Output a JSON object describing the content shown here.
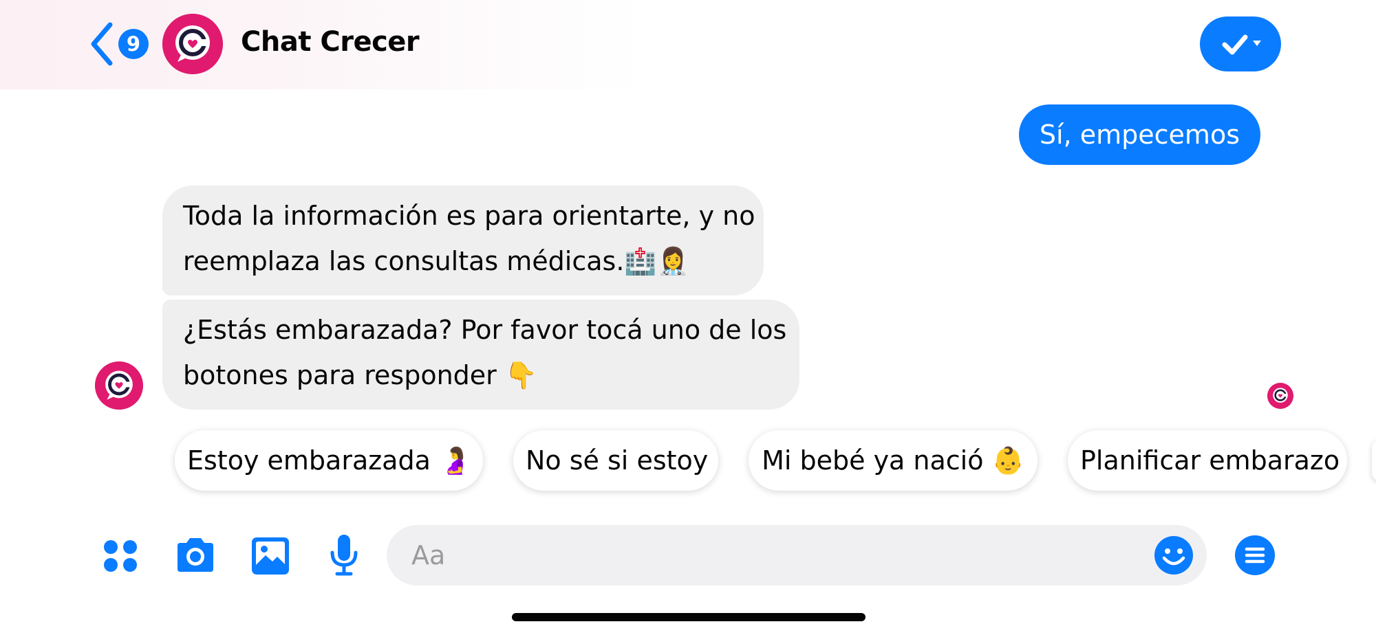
{
  "header": {
    "back_badge_count": "9",
    "title": "Chat Crecer",
    "icon_name": "checkmark-dropdown-icon"
  },
  "messages": {
    "outgoing": {
      "text": "Sí, empecemos"
    },
    "incoming": [
      {
        "line1": "Toda la información es para orientarte, y no",
        "line2_text": "reemplaza las consultas médicas.",
        "line2_emoji": "🏥👩‍⚕️"
      },
      {
        "line1": "¿Estás embarazada? Por favor tocá uno de los",
        "line2_text": "botones para responder ",
        "line2_emoji": "👇"
      }
    ]
  },
  "quick_replies": [
    {
      "label": "Estoy embarazada",
      "emoji": "🤰"
    },
    {
      "label": "No sé si estoy",
      "emoji": ""
    },
    {
      "label": "Mi bebé ya nació",
      "emoji": "👶"
    },
    {
      "label": "Planificar embarazo",
      "emoji": ""
    }
  ],
  "composer": {
    "placeholder": "Aa",
    "icons": [
      "apps-icon",
      "camera-icon",
      "gallery-icon",
      "microphone-icon",
      "emoji-icon",
      "menu-icon"
    ]
  },
  "colors": {
    "accent": "#0a7cff",
    "brand": "#e01a6f",
    "incoming_bubble": "#efefef"
  }
}
